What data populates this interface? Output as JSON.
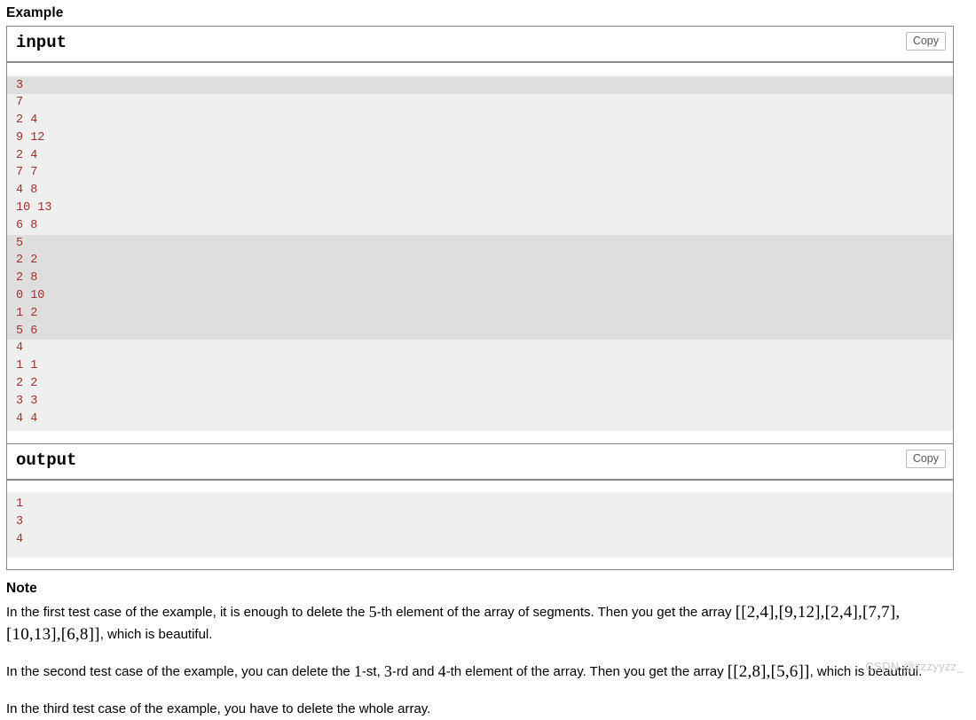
{
  "example": {
    "heading": "Example",
    "input": {
      "title": "input",
      "copy_label": "Copy",
      "groups": [
        {
          "shade": "a",
          "lines": [
            "3"
          ]
        },
        {
          "shade": "b",
          "lines": [
            "7",
            "2 4",
            "9 12",
            "2 4",
            "7 7",
            "4 8",
            "10 13",
            "6 8"
          ]
        },
        {
          "shade": "a",
          "lines": [
            "5",
            "2 2",
            "2 8",
            "0 10",
            "1 2",
            "5 6"
          ]
        },
        {
          "shade": "b",
          "lines": [
            "4",
            "1 1",
            "2 2",
            "3 3",
            "4 4"
          ]
        }
      ]
    },
    "output": {
      "title": "output",
      "copy_label": "Copy",
      "groups": [
        {
          "shade": "b",
          "lines": [
            "1",
            "3",
            "4"
          ]
        }
      ]
    }
  },
  "note": {
    "heading": "Note",
    "paragraphs": [
      {
        "parts": [
          {
            "type": "text",
            "value": "In the first test case of the example, it is enough to delete the "
          },
          {
            "type": "mathnum",
            "value": "5"
          },
          {
            "type": "text",
            "value": "-th element of the array of segments. Then you get the array "
          },
          {
            "type": "math",
            "value": "[[2,4],[9,12],[2,4],[7,7],[10,13],[6,8]]"
          },
          {
            "type": "text",
            "value": ", which is beautiful."
          }
        ]
      },
      {
        "parts": [
          {
            "type": "text",
            "value": "In the second test case of the example, you can delete the "
          },
          {
            "type": "mathnum",
            "value": "1"
          },
          {
            "type": "text",
            "value": "-st, "
          },
          {
            "type": "mathnum",
            "value": "3"
          },
          {
            "type": "text",
            "value": "-rd and "
          },
          {
            "type": "mathnum",
            "value": "4"
          },
          {
            "type": "text",
            "value": "-th element of the array. Then you get the array "
          },
          {
            "type": "math",
            "value": "[[2,8],[5,6]]"
          },
          {
            "type": "text",
            "value": ", which is beautiful."
          }
        ]
      },
      {
        "parts": [
          {
            "type": "text",
            "value": "In the third test case of the example, you have to delete the whole array."
          }
        ]
      }
    ]
  },
  "watermark": {
    "text": "CSDN @zzzyyzz_"
  }
}
